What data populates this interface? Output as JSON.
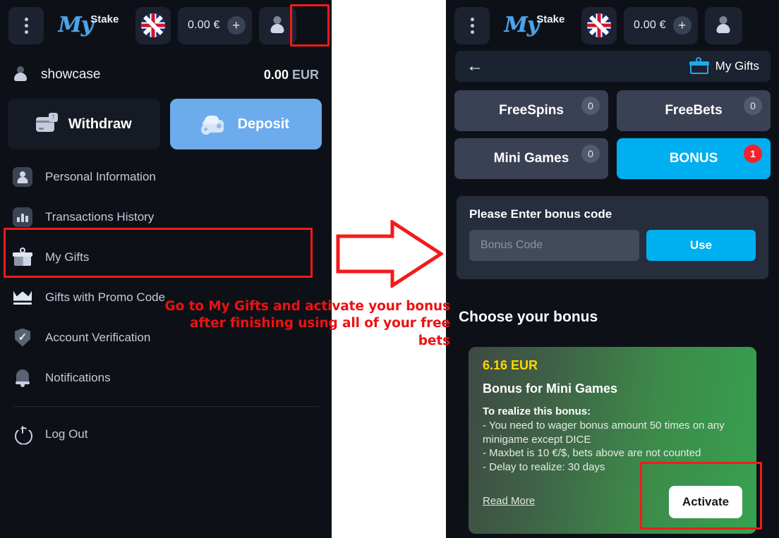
{
  "left_panel": {
    "topbar": {
      "menu_icon": "kebab-menu-icon",
      "logo_my": "My",
      "logo_stake": "Stake",
      "flag_icon": "uk-flag-icon",
      "balance": "0.00 €",
      "plus_label": "+",
      "avatar_icon": "user-avatar-icon"
    },
    "account": {
      "avatar_icon": "user-avatar-icon",
      "username": "showcase",
      "balance_amount": "0.00",
      "balance_currency": "EUR"
    },
    "actions": {
      "withdraw_label": "Withdraw",
      "withdraw_icon": "card-upload-icon",
      "deposit_label": "Deposit",
      "deposit_icon": "wallet-plus-icon"
    },
    "menu_items": [
      {
        "label": "Personal Information",
        "icon": "person-icon"
      },
      {
        "label": "Transactions History",
        "icon": "bar-chart-icon"
      },
      {
        "label": "My Gifts",
        "icon": "gift-icon"
      },
      {
        "label": "Gifts with Promo Code",
        "icon": "crown-icon"
      },
      {
        "label": "Account Verification",
        "icon": "shield-check-icon"
      },
      {
        "label": "Notifications",
        "icon": "bell-icon"
      },
      {
        "label": "Log Out",
        "icon": "power-icon"
      }
    ]
  },
  "annotation": {
    "line1": "Go to My Gifts and activate your bonus",
    "line2": "after finishing using all of your free bets",
    "arrow_icon": "right-arrow-annotation",
    "color": "#ee1111"
  },
  "right_panel": {
    "topbar": {
      "menu_icon": "kebab-menu-icon",
      "logo_my": "My",
      "logo_stake": "Stake",
      "flag_icon": "uk-flag-icon",
      "balance": "0.00 €",
      "plus_label": "+",
      "avatar_icon": "user-avatar-icon"
    },
    "header": {
      "back_icon": "back-arrow-icon",
      "back_glyph": "←",
      "gifts_icon": "gift-box-icon",
      "title": "My Gifts"
    },
    "tabs": [
      {
        "label": "FreeSpins",
        "badge": "0",
        "active": false
      },
      {
        "label": "FreeBets",
        "badge": "0",
        "active": false
      },
      {
        "label": "Mini Games",
        "badge": "0",
        "active": false
      },
      {
        "label": "BONUS",
        "badge": "1",
        "active": true
      }
    ],
    "bonus_code": {
      "title": "Please Enter bonus code",
      "input_value": "",
      "input_placeholder": "Bonus Code",
      "use_label": "Use"
    },
    "choose_title": "Choose your bonus",
    "bonus_card": {
      "amount": "6.16 EUR",
      "title": "Bonus for Mini Games",
      "terms_head": "To realize this bonus:",
      "terms": [
        "- You need to wager bonus amount 50 times on any minigame except DICE",
        "- Maxbet is 10 €/$, bets above are not counted",
        "- Delay to realize: 30 days"
      ],
      "read_more": "Read More",
      "activate_label": "Activate"
    }
  },
  "colors": {
    "panel_bg": "#0d1117",
    "accent_blue": "#00aff0",
    "deposit_blue": "#6cabec",
    "highlight_red": "#f41a1a",
    "badge_red": "#f5222d",
    "bonus_yellow": "#ffd500"
  }
}
